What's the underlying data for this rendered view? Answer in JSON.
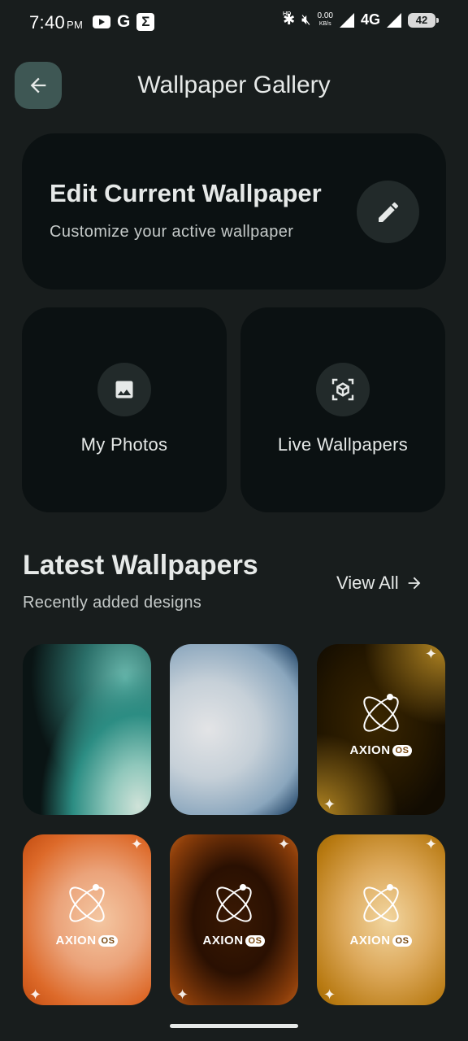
{
  "status_bar": {
    "time": "7:40",
    "ampm": "PM",
    "g_icon": "G",
    "sigma_icon": "Σ",
    "net_speed": "0.00",
    "net_unit": "KB/s",
    "hd1": "HD",
    "network": "4G",
    "hd2": "HD",
    "battery": "42"
  },
  "header": {
    "title": "Wallpaper Gallery",
    "back_icon": "arrow-left-icon"
  },
  "edit_card": {
    "title": "Edit Current Wallpaper",
    "subtitle": "Customize your active wallpaper",
    "icon": "pencil-icon"
  },
  "tiles": [
    {
      "label": "My Photos",
      "icon": "image-icon"
    },
    {
      "label": "Live Wallpapers",
      "icon": "3d-cube-icon"
    }
  ],
  "latest": {
    "title": "Latest Wallpapers",
    "subtitle": "Recently added designs",
    "view_all": "View All"
  },
  "thumbnails": [
    {
      "logo": ""
    },
    {
      "logo": ""
    },
    {
      "logo": "AXION",
      "logo_os": "OS"
    },
    {
      "logo": "AXION",
      "logo_os": "OS"
    },
    {
      "logo": "AXION",
      "logo_os": "OS"
    },
    {
      "logo": "AXION",
      "logo_os": "OS"
    }
  ],
  "colors": {
    "background": "#181d1d",
    "card": "#0b1112",
    "accent": "#3e5754"
  }
}
